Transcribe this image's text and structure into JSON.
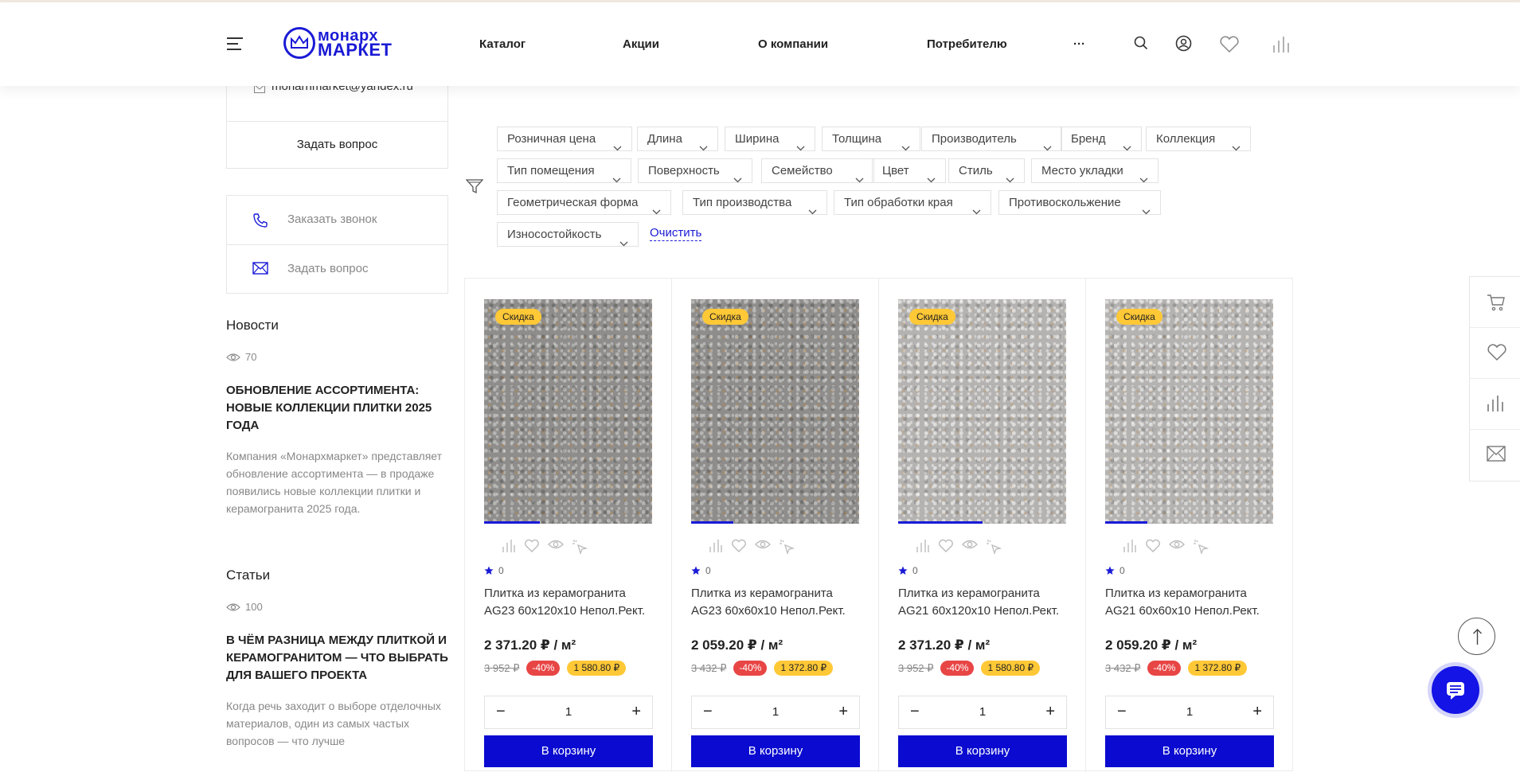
{
  "header": {
    "logo_line1": "МОНАРХ",
    "logo_line2": "МАРКЕТ",
    "nav": [
      "Каталог",
      "Акции",
      "О компании",
      "Потребителю",
      "···"
    ],
    "icons": [
      "search-icon",
      "user-icon",
      "heart-icon",
      "compare-icon"
    ]
  },
  "sidebar": {
    "email": "monarhmarket@yandex.ru",
    "ask_question": "Задать вопрос",
    "order_call": "Заказать звонок",
    "ask_question2": "Задать вопрос"
  },
  "news": {
    "heading": "Новости",
    "views": "70",
    "title": "ОБНОВЛЕНИЕ АССОРТИМЕНТА: НОВЫЕ КОЛЛЕКЦИИ ПЛИТКИ 2025 ГОДА",
    "text": "Компания «Монархмаркет» представляет обновление ассортимента — в продаже появились новые коллекции плитки и керамогранита 2025 года."
  },
  "articles": {
    "heading": "Статьи",
    "views": "100",
    "title": "В ЧЁМ РАЗНИЦА МЕЖДУ ПЛИТКОЙ И КЕРАМОГРАНИТОМ — ЧТО ВЫБРАТЬ ДЛЯ ВАШЕГО ПРОЕКТА",
    "text": "Когда речь заходит о выборе отделочных материалов, один из самых частых вопросов — что лучше"
  },
  "filters": [
    "Розничная цена",
    "Длина",
    "Ширина",
    "Толщина",
    "Производитель",
    "Бренд",
    "Коллекция",
    "Тип помещения",
    "Поверхность",
    "Семейство",
    "Цвет",
    "Стиль",
    "Место укладки",
    "Геометрическая форма",
    "Тип производства",
    "Тип обработки края",
    "Противоскольжение",
    "Износостойкость"
  ],
  "clear_label": "Очистить",
  "products": [
    {
      "badge": "Скидка",
      "rating": "0",
      "name_line1": "Плитка из керамогранита",
      "name_line2": "AG23 60x120x10 Непол.Рект.",
      "price": "2 371.20 ₽ / м²",
      "old_price": "3 952 ₽",
      "discount": "-40%",
      "saving": "1 580.80 ₽",
      "qty": "1",
      "cart": "В корзину",
      "tone": "dark",
      "gallery_progress": 0.33
    },
    {
      "badge": "Скидка",
      "rating": "0",
      "name_line1": "Плитка из керамогранита",
      "name_line2": "AG23 60x60x10 Непол.Рект.",
      "price": "2 059.20 ₽ / м²",
      "old_price": "3 432 ₽",
      "discount": "-40%",
      "saving": "1 372.80 ₽",
      "qty": "1",
      "cart": "В корзину",
      "tone": "dark",
      "gallery_progress": 0.25
    },
    {
      "badge": "Скидка",
      "rating": "0",
      "name_line1": "Плитка из керамогранита",
      "name_line2": "AG21 60x120x10 Непол.Рект.",
      "price": "2 371.20 ₽ / м²",
      "old_price": "3 952 ₽",
      "discount": "-40%",
      "saving": "1 580.80 ₽",
      "qty": "1",
      "cart": "В корзину",
      "tone": "light",
      "gallery_progress": 0.5
    },
    {
      "badge": "Скидка",
      "rating": "0",
      "name_line1": "Плитка из керамогранита",
      "name_line2": "AG21 60x60x10 Непол.Рект.",
      "price": "2 059.20 ₽ / м²",
      "old_price": "3 432 ₽",
      "discount": "-40%",
      "saving": "1 372.80 ₽",
      "qty": "1",
      "cart": "В корзину",
      "tone": "light",
      "gallery_progress": 0.25
    }
  ],
  "side_panel_icons": [
    "cart-icon",
    "heart-icon",
    "compare-icon",
    "mail-icon"
  ],
  "colors": {
    "brand": "#0a0ad0",
    "badge": "#ffc836",
    "discount": "#e84545"
  }
}
